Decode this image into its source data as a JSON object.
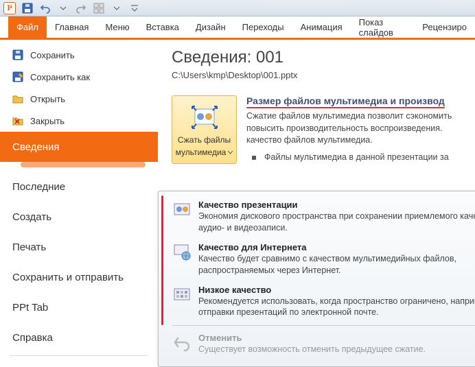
{
  "logo": "P",
  "ribbon": [
    "Файл",
    "Главная",
    "Меню",
    "Вставка",
    "Дизайн",
    "Переходы",
    "Анимация",
    "Показ слайдов",
    "Рецензиро"
  ],
  "ribbon_active": 0,
  "sidebar": {
    "quick": [
      {
        "label": "Сохранить",
        "icon": "save-icon"
      },
      {
        "label": "Сохранить как",
        "icon": "save-as-icon"
      },
      {
        "label": "Открыть",
        "icon": "open-icon"
      },
      {
        "label": "Закрыть",
        "icon": "close-file-icon"
      }
    ],
    "items": [
      "Сведения",
      "Последние",
      "Создать",
      "Печать",
      "Сохранить и отправить",
      "PPt Tab",
      "Справка"
    ],
    "active_index": 0
  },
  "main": {
    "title": "Сведения: 001",
    "path": "C:\\Users\\kmp\\Desktop\\001.pptx",
    "button_line1": "Сжать файлы",
    "button_line2": "мультимедиа",
    "heading": "Размер файлов мультимедиа и производ",
    "desc": "Сжатие файлов мультимедиа позволит сэкономить повысить производительность воспроизведения. качество файлов мультимедиа.",
    "bullet": "Файлы мультимедиа в данной презентации за"
  },
  "dropdown": {
    "options": [
      {
        "title": "Качество презентации",
        "desc": "Экономия дискового пространства при сохранении приемлемого качества аудио- и видеозаписи."
      },
      {
        "title": "Качество для Интернета",
        "desc": "Качество будет сравнимо с качеством мультимедийных файлов, распространяемых через Интернет."
      },
      {
        "title": "Низкое качество",
        "desc": "Рекомендуется использовать, когда пространство ограничено, например, для отправки презентаций по электронной почте."
      }
    ],
    "undo": {
      "title": "Отменить",
      "desc": "Существует возможность отменить предыдущее сжатие."
    }
  }
}
